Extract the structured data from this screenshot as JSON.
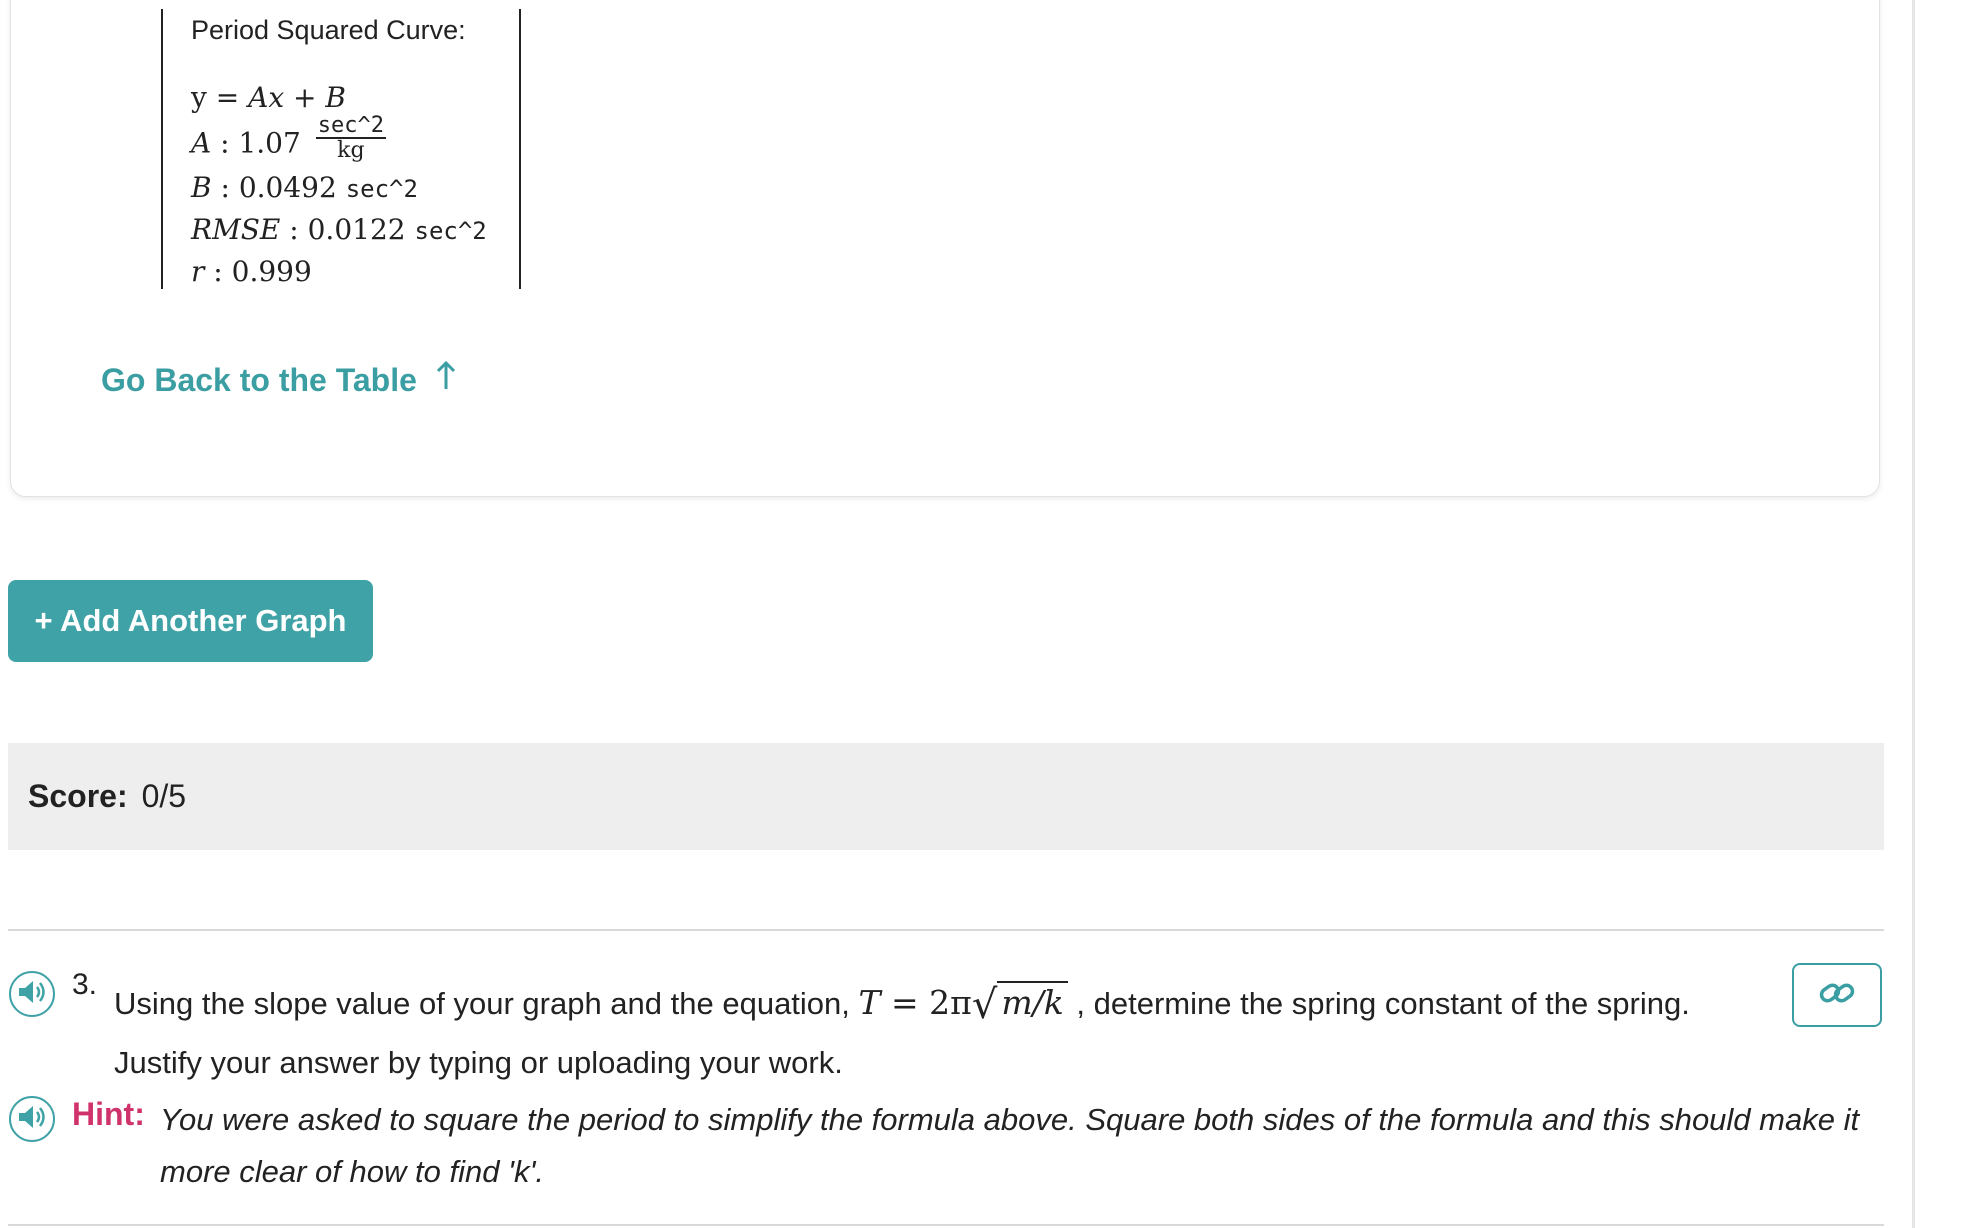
{
  "curve": {
    "title": "Period Squared Curve:",
    "equation": {
      "y": "y",
      "eq": " = ",
      "rhs": "Ax + B"
    },
    "a": {
      "label": "A",
      "value": "1.07",
      "unit_num": "sec^2",
      "unit_den": "kg"
    },
    "b": {
      "label": "B",
      "value": "0.0492",
      "unit": "sec^2"
    },
    "rmse": {
      "label": "RMSE",
      "value": "0.0122",
      "unit": "sec^2"
    },
    "r": {
      "label": "r",
      "value": "0.999"
    }
  },
  "go_back_label": "Go Back to the Table",
  "add_graph_label": "+ Add Another Graph",
  "score": {
    "label": "Score:",
    "value": "0/5"
  },
  "question": {
    "number": "3.",
    "text_before": "Using the slope value of your graph and the equation, ",
    "math_lhs": "T",
    "math_eq": " = 2π",
    "math_radicand": "m/k",
    "text_after": " , determine the spring constant of the spring. Justify your answer by typing or uploading your work."
  },
  "hint": {
    "label": "Hint:",
    "text": "You were asked to square the period to simplify the formula above. Square both sides of the formula and this should make it more clear of how to find 'k'."
  },
  "icons": {
    "audio": "speaker-icon",
    "link": "link-icon",
    "arrow": "arrow-up-icon"
  },
  "colors": {
    "accent": "#3fa2a6",
    "hint": "#d0336b",
    "score_bg": "#eeeeee"
  }
}
